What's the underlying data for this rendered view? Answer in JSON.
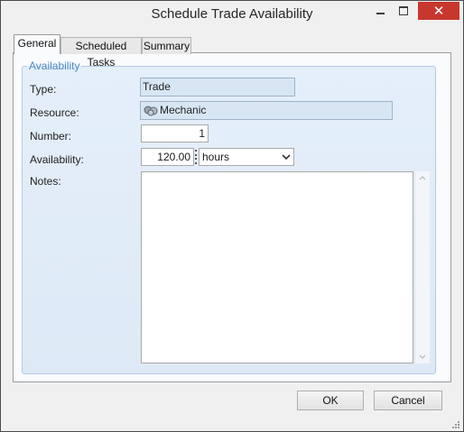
{
  "window": {
    "title": "Schedule Trade Availability"
  },
  "tabs": [
    {
      "label": "General",
      "active": true
    },
    {
      "label": "Scheduled Tasks",
      "active": false
    },
    {
      "label": "Summary",
      "active": false
    }
  ],
  "availability": {
    "legend": "Availability",
    "type_label": "Type:",
    "type_value": "Trade",
    "resource_label": "Resource:",
    "resource_value": "Mechanic",
    "resource_icon": "trade-group-icon",
    "number_label": "Number:",
    "number_value": "1",
    "availability_label": "Availability:",
    "availability_value": "120.00",
    "unit_selected": "hours",
    "notes_label": "Notes:",
    "notes_value": ""
  },
  "buttons": {
    "ok": "OK",
    "cancel": "Cancel"
  },
  "colors": {
    "group_fill": "#e4effa",
    "legend_text": "#4a86c4",
    "close_button": "#c7372e"
  }
}
